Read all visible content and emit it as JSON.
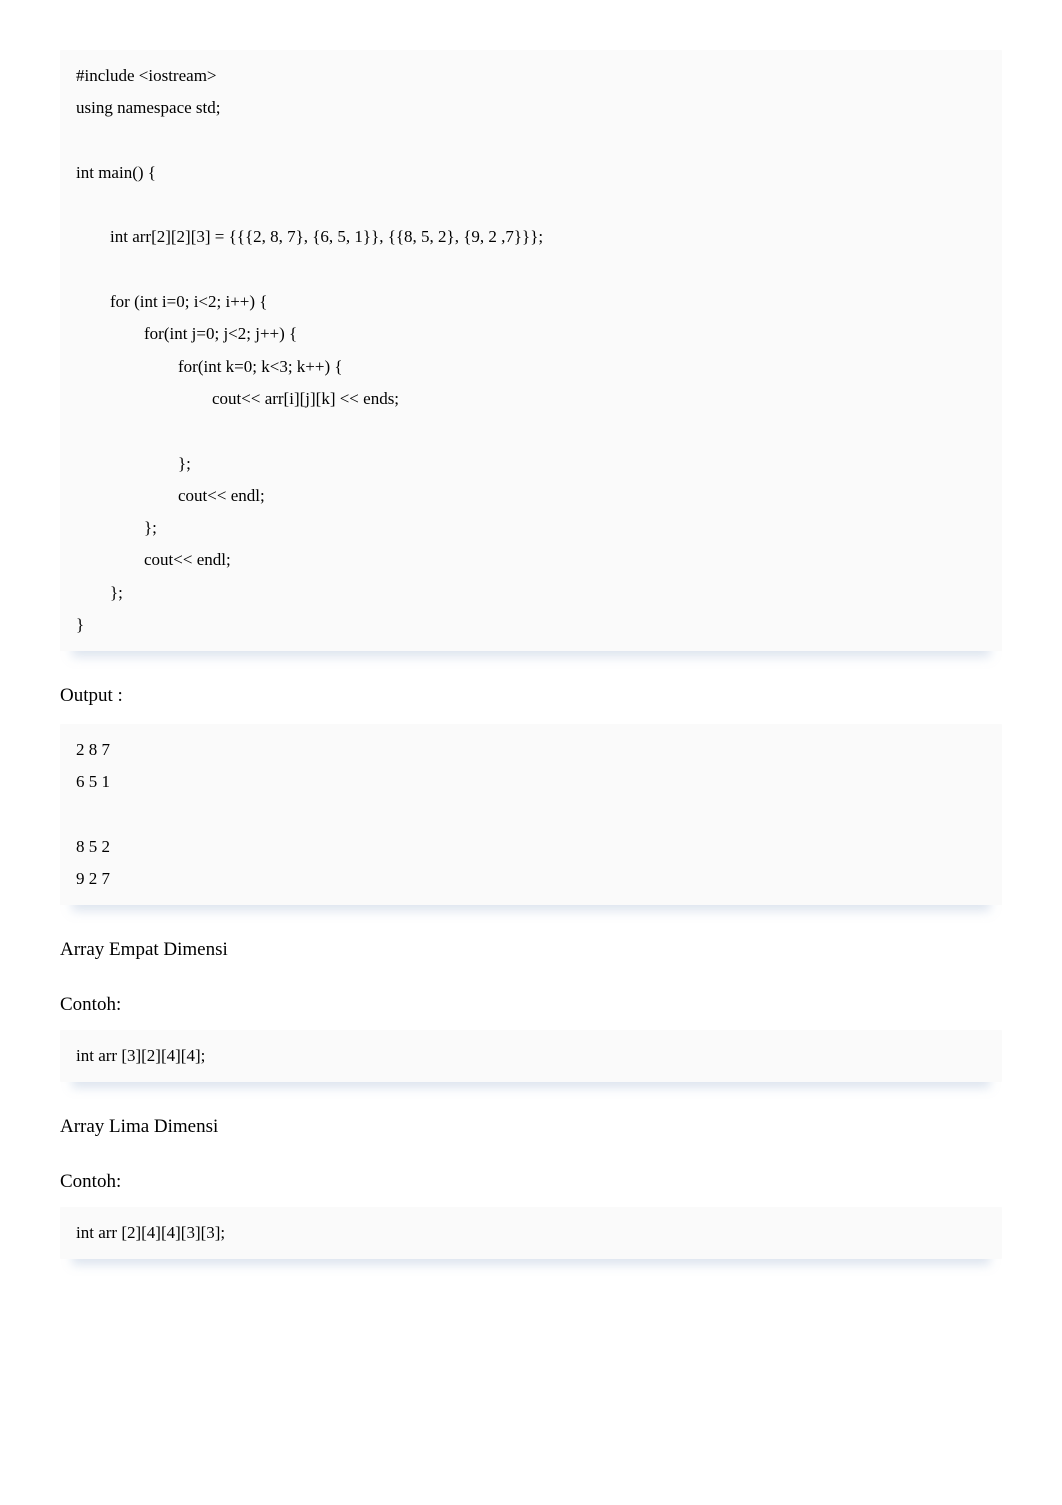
{
  "codeBlock1": "#include <iostream>\nusing namespace std;\n\nint main() {\n\n        int arr[2][2][3] = {{{2, 8, 7}, {6, 5, 1}}, {{8, 5, 2}, {9, 2 ,7}}};\n\n        for (int i=0; i<2; i++) {\n                for(int j=0; j<2; j++) {\n                        for(int k=0; k<3; k++) {\n                                cout<< arr[i][j][k] << ends;\n\n                        };\n                        cout<< endl;\n                };\n                cout<< endl;\n        };\n}",
  "outputLabel": "Output :",
  "outputBlock": "2 8 7\n6 5 1\n\n8 5 2\n9 2 7",
  "section4d": {
    "title": "Array Empat Dimensi",
    "contoh": "Contoh:",
    "code": "int arr [3][2][4][4];"
  },
  "section5d": {
    "title": "Array Lima Dimensi",
    "contoh": "Contoh:",
    "code": "int arr [2][4][4][3][3];"
  }
}
